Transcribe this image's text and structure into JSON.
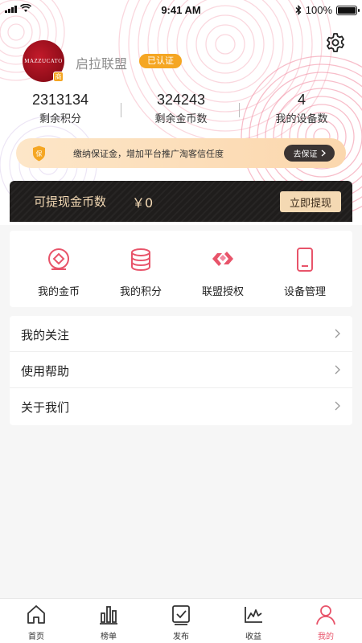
{
  "status_bar": {
    "time": "9:41 AM",
    "battery": "100%"
  },
  "profile": {
    "avatar_text": "MAZZUCATO",
    "avatar_badge": "商",
    "name": "启拉联盟",
    "verified": "已认证"
  },
  "stats": [
    {
      "value": "2313134",
      "label": "剩余积分"
    },
    {
      "value": "324243",
      "label": "剩余金币数"
    },
    {
      "value": "4",
      "label": "我的设备数"
    }
  ],
  "deposit": {
    "icon_text": "保",
    "text": "缴纳保证金，增加平台推广淘客信任度",
    "button": "去保证"
  },
  "withdraw": {
    "label": "可提现金币数",
    "amount": "￥0",
    "button": "立即提现"
  },
  "actions": [
    {
      "label": "我的金币",
      "icon": "coin-icon"
    },
    {
      "label": "我的积分",
      "icon": "database-icon"
    },
    {
      "label": "联盟授权",
      "icon": "alliance-icon"
    },
    {
      "label": "设备管理",
      "icon": "phone-icon"
    }
  ],
  "menu": [
    {
      "label": "我的关注"
    },
    {
      "label": "使用帮助"
    },
    {
      "label": "关于我们"
    }
  ],
  "tabs": [
    {
      "label": "首页",
      "icon": "home-icon"
    },
    {
      "label": "榜单",
      "icon": "chart-icon"
    },
    {
      "label": "发布",
      "icon": "publish-icon"
    },
    {
      "label": "收益",
      "icon": "income-icon"
    },
    {
      "label": "我的",
      "icon": "user-icon",
      "active": true
    }
  ],
  "colors": {
    "accent": "#e8546a",
    "badge": "#f5a623",
    "gold_text": "#f3d9b4",
    "dark_bar": "#1f1d1c"
  }
}
